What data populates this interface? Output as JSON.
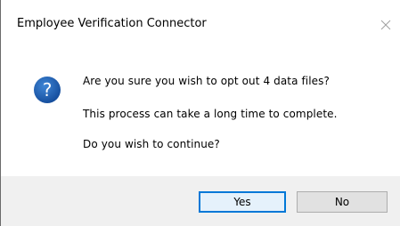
{
  "window": {
    "title": "Employee Verification Connector",
    "close_icon": "close-icon"
  },
  "message": {
    "icon": "question-icon",
    "icon_color": "#1e5fb4",
    "lines": [
      "Are you sure you wish to opt out 4 data files?",
      "This process can take a long time to complete.",
      "Do you wish to continue?"
    ]
  },
  "buttons": {
    "yes_label": "Yes",
    "no_label": "No",
    "default": "Yes",
    "accent": "#0078d7"
  }
}
